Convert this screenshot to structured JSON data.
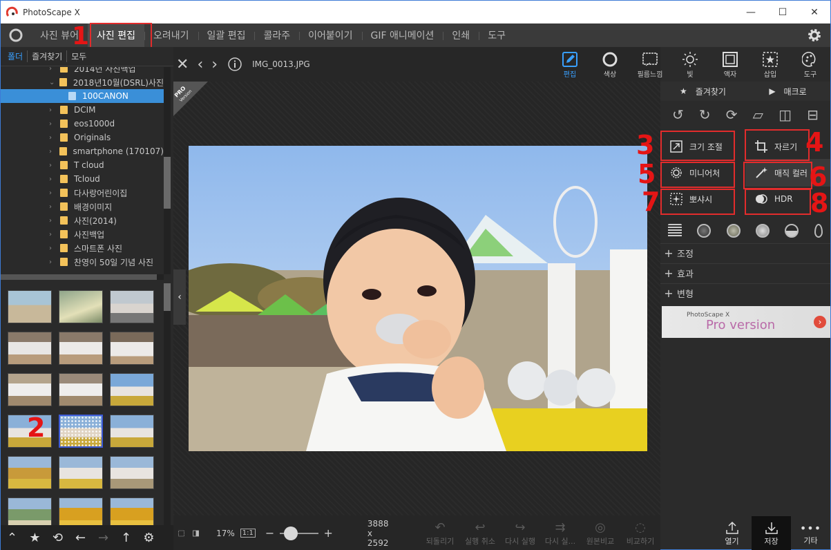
{
  "window": {
    "title": "PhotoScape X",
    "minimize": "—",
    "maximize": "☐",
    "close": "✕"
  },
  "menu": {
    "items": [
      "사진 뷰어",
      "사진 편집",
      "오려내기",
      "일괄 편집",
      "콜라주",
      "이어붙이기",
      "GIF 애니메이션",
      "인쇄",
      "도구"
    ],
    "active_index": 1
  },
  "left": {
    "tabs": [
      "폴더",
      "즐겨찾기",
      "모두"
    ],
    "tree": [
      {
        "label": "2014년 사진백업",
        "level": 1,
        "expanded": false
      },
      {
        "label": "2018년10월(DSRL)사진",
        "level": 1,
        "expanded": true
      },
      {
        "label": "100CANON",
        "level": 2,
        "selected": true
      },
      {
        "label": "DCIM",
        "level": 1
      },
      {
        "label": "eos1000d",
        "level": 1
      },
      {
        "label": "Originals",
        "level": 1
      },
      {
        "label": "smartphone (170107)",
        "level": 1
      },
      {
        "label": "T cloud",
        "level": 1
      },
      {
        "label": "Tcloud",
        "level": 1
      },
      {
        "label": "다사랑어린이집",
        "level": 1
      },
      {
        "label": "배경이미지",
        "level": 1
      },
      {
        "label": "사진(2014)",
        "level": 1
      },
      {
        "label": "사진백업",
        "level": 1
      },
      {
        "label": "스마트폰 사진",
        "level": 1
      },
      {
        "label": "찬영이 50일 기념 사진",
        "level": 1
      }
    ]
  },
  "viewer": {
    "filename": "IMG_0013.JPG",
    "pro_badge": "PRO",
    "pro_badge_sub": "Version",
    "zoom": "17%",
    "one_to_one": "1:1",
    "dimensions": "3888 x 2592",
    "zoom_fraction": 0.14
  },
  "toolbar": {
    "items": [
      {
        "label": "편집",
        "icon": "edit-icon",
        "active": true
      },
      {
        "label": "색상",
        "icon": "circle-icon"
      },
      {
        "label": "필름느낌",
        "icon": "film-icon"
      },
      {
        "label": "빛",
        "icon": "sun-icon"
      },
      {
        "label": "액자",
        "icon": "frame-icon"
      },
      {
        "label": "삽입",
        "icon": "insert-icon"
      },
      {
        "label": "도구",
        "icon": "palette-icon"
      }
    ]
  },
  "right": {
    "favorites": "즐겨찾기",
    "macro": "매크로",
    "buttons": {
      "resize": "크기 조절",
      "crop": "자르기",
      "miniature": "미니어처",
      "magic_color": "매직 컬러",
      "bokeh": "뽀샤시",
      "hdr": "HDR"
    },
    "sections": [
      "조정",
      "효과",
      "변형"
    ],
    "banner": {
      "brand": "PhotoScape X",
      "text": "Pro version",
      "arrow": "›"
    }
  },
  "bottom": {
    "undo": [
      {
        "label": "되돌리기"
      },
      {
        "label": "실행 취소"
      },
      {
        "label": "다시 실행"
      },
      {
        "label": "다시 실..."
      },
      {
        "label": "원본비교"
      },
      {
        "label": "비교하기"
      }
    ],
    "open": "열기",
    "save": "저장",
    "more": "기타"
  },
  "annotations": [
    "1",
    "2",
    "3",
    "4",
    "5",
    "6",
    "7",
    "8"
  ],
  "colors": {
    "accent": "#39a0ff",
    "annotation": "#e51515",
    "border": "#3d7bd6"
  }
}
